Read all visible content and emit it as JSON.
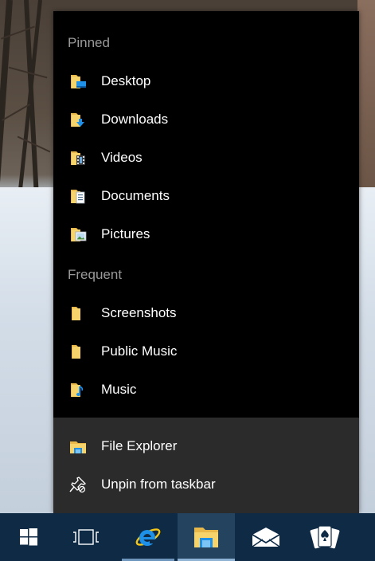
{
  "jumplist": {
    "pinned_header": "Pinned",
    "pinned": [
      {
        "label": "Desktop",
        "icon": "folder-desktop-icon"
      },
      {
        "label": "Downloads",
        "icon": "folder-downloads-icon"
      },
      {
        "label": "Videos",
        "icon": "folder-videos-icon"
      },
      {
        "label": "Documents",
        "icon": "folder-documents-icon"
      },
      {
        "label": "Pictures",
        "icon": "folder-pictures-icon"
      }
    ],
    "frequent_header": "Frequent",
    "frequent": [
      {
        "label": "Screenshots",
        "icon": "folder-icon"
      },
      {
        "label": "Public Music",
        "icon": "folder-icon"
      },
      {
        "label": "Music",
        "icon": "folder-music-icon"
      }
    ],
    "tasks": [
      {
        "label": "File Explorer",
        "icon": "file-explorer-icon"
      },
      {
        "label": "Unpin from taskbar",
        "icon": "unpin-icon"
      }
    ]
  },
  "taskbar": {
    "buttons": [
      {
        "name": "start-button",
        "icon": "windows-logo-icon"
      },
      {
        "name": "task-view-button",
        "icon": "task-view-icon"
      },
      {
        "name": "internet-explorer-button",
        "icon": "internet-explorer-icon",
        "running": true
      },
      {
        "name": "file-explorer-taskbar-button",
        "icon": "file-explorer-icon",
        "active": true
      },
      {
        "name": "mail-button",
        "icon": "mail-icon"
      },
      {
        "name": "solitaire-button",
        "icon": "solitaire-cards-icon"
      }
    ]
  },
  "colors": {
    "menu_bg": "#000000",
    "tasks_bg": "#2b2b2b",
    "taskbar_bg": "#0e2a45",
    "taskbar_active": "#24435f",
    "folder_yellow": "#f6d36b",
    "accent_blue": "#1e90e8",
    "header_text": "#9a9a9a"
  }
}
